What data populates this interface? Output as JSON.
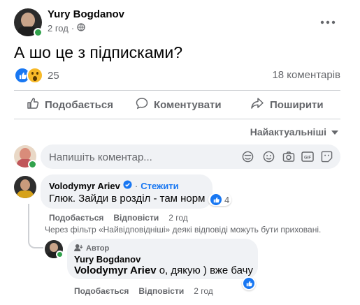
{
  "post": {
    "author": "Yury Bogdanov",
    "time": "2 год",
    "privacy_icon": "globe-icon",
    "text": "А шо це з підписками?",
    "reactions_count": "25",
    "comments_count": "18 коментарів"
  },
  "actions": {
    "like": "Подобається",
    "comment": "Коментувати",
    "share": "Поширити"
  },
  "sort": {
    "label": "Найактуальніші"
  },
  "composer": {
    "placeholder": "Напишіть коментар..."
  },
  "comments": [
    {
      "author": "Volodymyr Ariev",
      "follow": "Стежити",
      "text": "Глюк. Зайди в розділ - там норм",
      "reaction_count": "4",
      "like": "Подобається",
      "reply": "Відповісти",
      "time": "2 год"
    }
  ],
  "filter_note": "Через фільтр «Найвідповідніші» деякі відповіді можуть бути приховані.",
  "reply": {
    "badge": "Автор",
    "author": "Yury Bogdanov",
    "mention": "Volodymyr Ariev",
    "text": " о, дякую ) вже бачу",
    "like": "Подобається",
    "reply": "Відповісти",
    "time": "2 год"
  },
  "colors": {
    "accent": "#1877f2",
    "online": "#31a24c",
    "bubble": "#f0f2f5",
    "muted": "#65676b"
  }
}
